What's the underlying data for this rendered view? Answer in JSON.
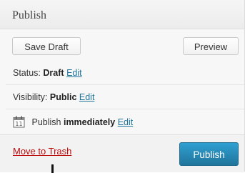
{
  "box": {
    "title": "Publish"
  },
  "actions": {
    "save_draft_label": "Save Draft",
    "preview_label": "Preview"
  },
  "status": {
    "label": "Status:",
    "value": "Draft",
    "edit": "Edit"
  },
  "visibility": {
    "label": "Visibility:",
    "value": "Public",
    "edit": "Edit"
  },
  "schedule": {
    "label": "Publish",
    "value": "immediately",
    "edit": "Edit",
    "icon": "calendar-icon"
  },
  "footer": {
    "trash_label": "Move to Trash",
    "publish_label": "Publish"
  },
  "colors": {
    "link": "#21759b",
    "publish_button": "#2e9fd2",
    "trash": "#bc0b0b"
  }
}
